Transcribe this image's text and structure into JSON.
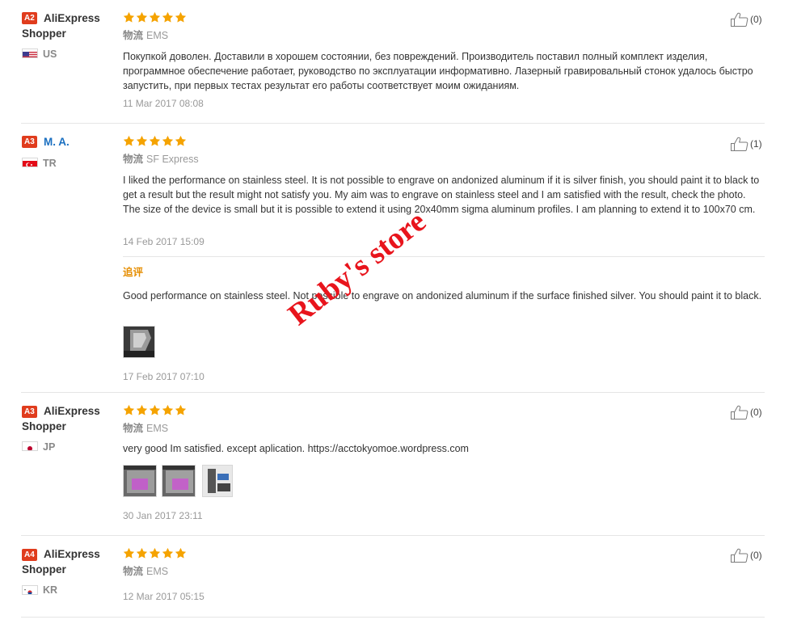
{
  "colors": {
    "badge": "#e03c1d",
    "star": "#f5a300",
    "name_blue": "#1a6fc0",
    "followup": "#e58d00",
    "watermark": "#e8141c"
  },
  "labels": {
    "logistics": "物流",
    "followup": "追评"
  },
  "watermark": "Ruby's store",
  "reviews": [
    {
      "level": "A2",
      "name": "AliExpress Shopper",
      "country": "US",
      "stars": 5,
      "shipping": "EMS",
      "text": "Покупкой доволен. Доставили в хорошем состоянии, без повреждений. Производитель поставил полный комплект изделия, программное обеспечение работает, руководство по эксплуатации информативно. Лазерный гравировальный стонок удалось быстро запустить, при первых тестах результат его работы соответствует моим ожиданиям.",
      "date": "11 Mar 2017 08:08",
      "helpful": "(0)"
    },
    {
      "level": "A3",
      "name": "M. A.",
      "country": "TR",
      "stars": 5,
      "shipping": "SF Express",
      "text": "I liked the performance on stainless steel. It is not possible to engrave on andonized aluminum if it is silver finish, you should paint it to black to get a result but the result might not satisfy you. My aim was to engrave on stainless steel and I am satisfied with the result, check the photo. The size of the device is small but it is possible to extend it using 20x40mm sigma aluminum profiles. I am planning to extend it to 100x70 cm.",
      "date": "14 Feb 2017 15:09",
      "helpful": "(1)",
      "followup": {
        "text": "Good performance on stainless steel. Not possible to engrave on andonized aluminum if the surface finished silver. You should paint it to black.",
        "date": "17 Feb 2017 07:10"
      }
    },
    {
      "level": "A3",
      "name": "AliExpress Shopper",
      "country": "JP",
      "stars": 5,
      "shipping": "EMS",
      "text": "very good Im satisfied. except aplication. https://acctokyomoe.wordpress.com",
      "date": "30 Jan 2017 23:11",
      "helpful": "(0)"
    },
    {
      "level": "A4",
      "name": "AliExpress Shopper",
      "country": "KR",
      "stars": 5,
      "shipping": "EMS",
      "date": "12 Mar 2017 05:15",
      "helpful": "(0)"
    }
  ]
}
